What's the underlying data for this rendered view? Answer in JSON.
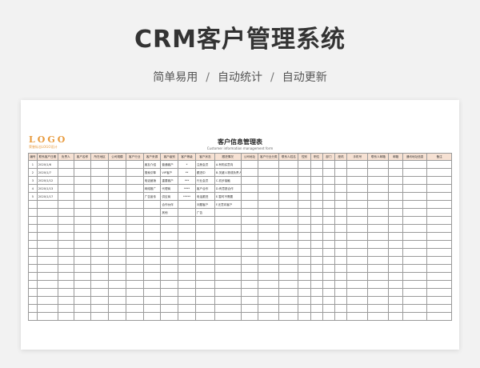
{
  "hero": {
    "title": "CRM客户管理系统",
    "features": [
      "简单易用",
      "自动统计",
      "自动更新"
    ]
  },
  "sheet": {
    "logo_mark": "LOGO",
    "logo_text": "荣誉标志LOGO设计",
    "title": "客户信息管理表",
    "subtitle": "Customer information management form",
    "header_color": "#f6e1d3",
    "columns": [
      "编号",
      "联系客户日期",
      "负责人",
      "客户名称",
      "所在地区",
      "公司规模",
      "客户行业",
      "客户来源",
      "客户级别",
      "客户等级",
      "客户状态",
      "跟进情况",
      "公司地址",
      "客户行业分类",
      "联系人姓名",
      "性别",
      "职位",
      "部门",
      "座机",
      "手机号",
      "联系人邮箱",
      "邮箱",
      "通讯地址信息",
      "备注"
    ],
    "rows": [
      [
        "1",
        "2020/1/6",
        "",
        "",
        "",
        "",
        "",
        "朋友介绍",
        "普通客户",
        "*",
        "注册会员",
        "A.有购买意向",
        "",
        "",
        "",
        "",
        "",
        "",
        "",
        "",
        "",
        "",
        "",
        ""
      ],
      [
        "2",
        "2020/1/7",
        "",
        "",
        "",
        "",
        "",
        "搜索引擎",
        "VIP客户",
        "**",
        "跟进中",
        "B.关键人物或负责人",
        "",
        "",
        "",
        "",
        "",
        "",
        "",
        "",
        "",
        "",
        "",
        ""
      ],
      [
        "3",
        "2020/1/12",
        "",
        "",
        "",
        "",
        "",
        "电话营销",
        "重要客户",
        "***",
        "行业会员",
        "C.初步接触",
        "",
        "",
        "",
        "",
        "",
        "",
        "",
        "",
        "",
        "",
        "",
        ""
      ],
      [
        "4",
        "2020/1/13",
        "",
        "",
        "",
        "",
        "",
        "网络推广",
        "代理商",
        "****",
        "客户合作",
        "D.有意愿合作",
        "",
        "",
        "",
        "",
        "",
        "",
        "",
        "",
        "",
        "",
        "",
        ""
      ],
      [
        "5",
        "2020/1/17",
        "",
        "",
        "",
        "",
        "",
        "广告宣传",
        "供应商",
        "*****",
        "电话跟进",
        "E.暂时不需要",
        "",
        "",
        "",
        "",
        "",
        "",
        "",
        "",
        "",
        "",
        "",
        ""
      ],
      [
        "",
        "",
        "",
        "",
        "",
        "",
        "",
        "",
        "合作伙伴",
        "",
        "问题客户",
        "F.无意向客户",
        "",
        "",
        "",
        "",
        "",
        "",
        "",
        "",
        "",
        "",
        "",
        ""
      ],
      [
        "",
        "",
        "",
        "",
        "",
        "",
        "",
        "",
        "其他",
        "",
        "广告",
        "",
        "",
        "",
        "",
        "",
        "",
        "",
        "",
        "",
        "",
        "",
        "",
        ""
      ]
    ],
    "empty_rows": 13
  }
}
